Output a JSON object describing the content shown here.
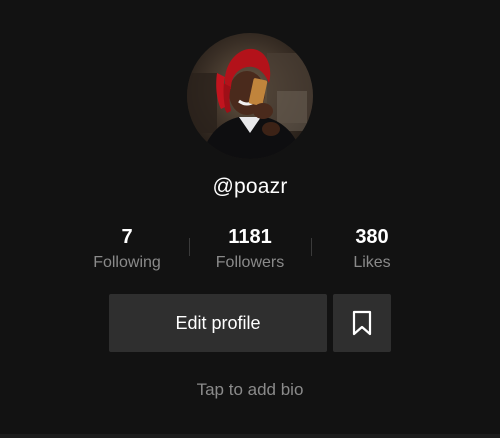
{
  "profile": {
    "username": "@poazr",
    "avatar_icon": "profile-photo"
  },
  "stats": {
    "following": {
      "value": "7",
      "label": "Following"
    },
    "followers": {
      "value": "1181",
      "label": "Followers"
    },
    "likes": {
      "value": "380",
      "label": "Likes"
    }
  },
  "actions": {
    "edit_profile_label": "Edit profile",
    "bookmark_icon": "bookmark-icon"
  },
  "bio": {
    "placeholder": "Tap to add bio"
  },
  "colors": {
    "background": "#121212",
    "button_bg": "#2f2f2f",
    "muted_text": "#8a8a8a"
  }
}
